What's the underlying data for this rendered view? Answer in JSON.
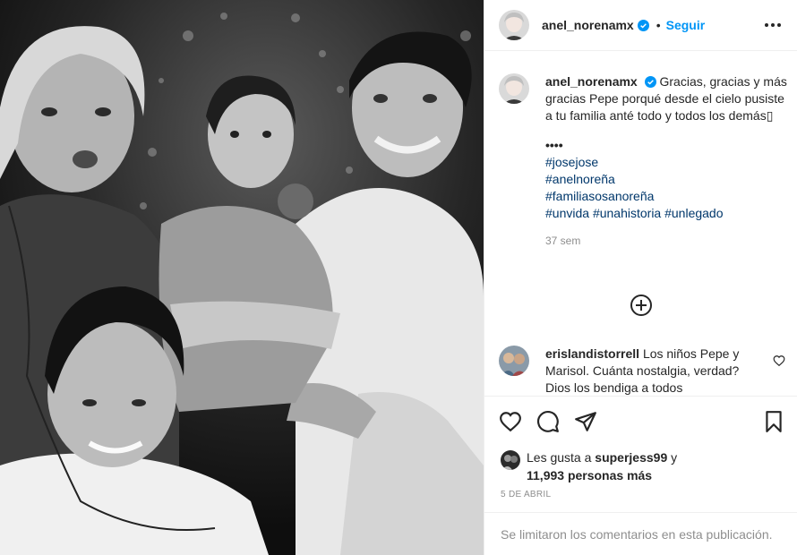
{
  "photo": {
    "alt_icon": "family-photo"
  },
  "header": {
    "username": "anel_norenamx",
    "separator": "•",
    "follow_label": "Seguir",
    "more_icon": "more-options-icon"
  },
  "caption": {
    "username": "anel_norenamx",
    "text": "Gracias, gracias y más gracias Pepe porqué desde el cielo pusiste a tu familia anté todo y todos los demás▯",
    "dots": "••••",
    "hashtags": [
      "#josejose",
      "#anelnoreña",
      "#familiasosanoreña"
    ],
    "hashtags_line": [
      "#unvida",
      "#unahistoria",
      "#unlegado"
    ],
    "time": "37 sem"
  },
  "comment": {
    "username": "erislandistorrell",
    "text": "Los niños Pepe y Marisol. Cuánta nostalgia, verdad? Dios los bendiga a todos"
  },
  "likes": {
    "prefix": "Les gusta a",
    "user": "superjess99",
    "conj": "y",
    "others": "11,993 personas más"
  },
  "date": "5 DE ABRIL",
  "comments_limited": "Se limitaron los comentarios en esta publicación.",
  "colors": {
    "accent": "#0095f6",
    "hashtag": "#00376b",
    "muted": "#8e8e8e",
    "border": "#efefef"
  }
}
